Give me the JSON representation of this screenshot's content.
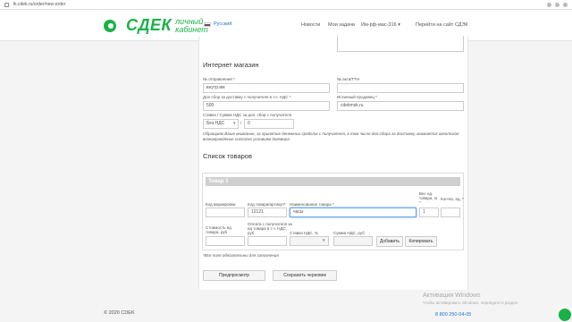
{
  "browser": {
    "url": "lk.cdek.ru/order/new-order"
  },
  "header": {
    "logo_text": "СДЕК",
    "logo_sub_line1": "личный",
    "logo_sub_line2": "кабинет",
    "language": "Русский",
    "nav": [
      "Новости",
      "Мои задачи",
      "Им-рф-мас-316 ▾",
      "Перейти на сайт СДЭК"
    ]
  },
  "online_shop": {
    "title": "Интернет магазин",
    "shipment_no_label": "№ отправления *",
    "shipment_no_value": "внутр.им",
    "act_no_label": "№ акта/ТТН",
    "act_no_value": "",
    "extra_fee_label": "Доп сбор за доставку с получателя в т.ч. НДС *",
    "extra_fee_value": "500",
    "true_seller_label": "Истинный продавец *",
    "true_seller_value": "cdekmsk.ru",
    "vat_label": "Ставка / Сумма НДС за доп. сбор с получателя",
    "vat_rate_value": "Без НДС",
    "vat_sum_value": "0",
    "note": "Обращаем Ваше внимание, за принятие денежных средств с получателя, в том числе доп.сбора за доставку, взимается агентское вознаграждение согласно условиям договора"
  },
  "goods": {
    "title": "Список товаров",
    "item_title": "Товар 1",
    "marking_label": "Код маркировки",
    "article_label": "Код товара/артикул*",
    "article_value": "12121",
    "name_label": "Наименование товара *",
    "name_value": "часы",
    "weight_label": "Вес ед. товара, кг *",
    "weight_value": "1",
    "qty_label": "Кол-во, ед. *",
    "cost_label": "Стоимость ед. товара, руб",
    "payment_label": "Оплата с получателя за ед товара в т.ч. НДС, руб",
    "vat_rate_label": "Ставка НДС, %",
    "vat_sum_label": "Сумма НДС, руб",
    "add_label": "Добавить",
    "copy_label": "Копировать"
  },
  "required_note": "*Все поля обязательны для заполнения",
  "actions": {
    "preview": "Предпросмотр",
    "save_draft": "Сохранить черновик"
  },
  "footer": {
    "copyright": "© 2020 CDEK",
    "phone": "8 800 250-04-05"
  },
  "watermark": {
    "line1": "Активация Windows",
    "line2": "Чтобы активировать Windows, перейдите в раздел"
  },
  "colors": {
    "brand": "#1ab248",
    "link": "#1a73c8"
  }
}
